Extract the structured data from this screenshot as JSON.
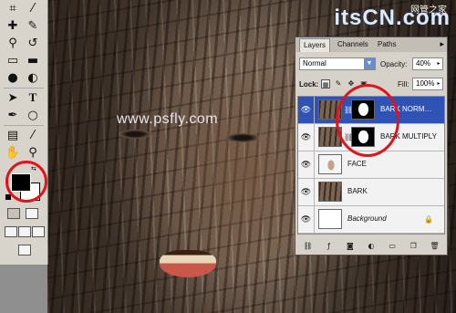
{
  "canvas": {
    "watermark": "www.psfly.com",
    "logo": {
      "text": "itsCN.com",
      "subtitle": "",
      "chinese": "网管之家"
    }
  },
  "toolbar": {
    "tools": [
      {
        "name": "crop-tool-icon",
        "glyph": "⌗"
      },
      {
        "name": "slice-tool-icon",
        "glyph": "⁄"
      },
      {
        "name": "healing-brush-icon",
        "glyph": "✚"
      },
      {
        "name": "brush-tool-icon",
        "glyph": "✎"
      },
      {
        "name": "clone-stamp-icon",
        "glyph": "⚲"
      },
      {
        "name": "history-brush-icon",
        "glyph": "↺"
      },
      {
        "name": "eraser-tool-icon",
        "glyph": "▭"
      },
      {
        "name": "gradient-tool-icon",
        "glyph": "▬"
      },
      {
        "name": "blur-tool-icon",
        "glyph": "●"
      },
      {
        "name": "dodge-tool-icon",
        "glyph": "◐"
      },
      {
        "name": "path-select-icon",
        "glyph": "➤"
      },
      {
        "name": "type-tool-icon",
        "glyph": "T"
      },
      {
        "name": "pen-tool-icon",
        "glyph": "✒"
      },
      {
        "name": "shape-tool-icon",
        "glyph": "○"
      },
      {
        "name": "notes-tool-icon",
        "glyph": "▤"
      },
      {
        "name": "eyedropper-tool-icon",
        "glyph": "⁄"
      },
      {
        "name": "hand-tool-icon",
        "glyph": "✋"
      },
      {
        "name": "zoom-tool-icon",
        "glyph": "⚲"
      }
    ],
    "swap_glyph": "⇆"
  },
  "layers_panel": {
    "tabs": [
      "Layers",
      "Channels",
      "Paths"
    ],
    "menu_arrow": "▸",
    "blend_mode": "Normal",
    "opacity_label": "Opacity:",
    "opacity_value": "40%",
    "lock_label": "Lock:",
    "fill_label": "Fill:",
    "fill_value": "100%",
    "layers": [
      {
        "name": "BARK NORM…",
        "selected": true,
        "thumb": "bark",
        "mask": true
      },
      {
        "name": "BARK MULTIPLY",
        "selected": false,
        "thumb": "bark",
        "mask": true
      },
      {
        "name": "FACE",
        "selected": false,
        "thumb": "face",
        "mask": false
      },
      {
        "name": "BARK",
        "selected": false,
        "thumb": "bark",
        "mask": false
      },
      {
        "name": "Background",
        "selected": false,
        "thumb": "white",
        "mask": false,
        "locked": true
      }
    ],
    "footer_icons": [
      "link-icon",
      "fx-icon",
      "mask-icon",
      "adjustment-icon",
      "folder-icon",
      "new-layer-icon",
      "trash-icon"
    ]
  },
  "colors": {
    "highlight": "#2e53b5",
    "annotation": "#e0141b"
  }
}
